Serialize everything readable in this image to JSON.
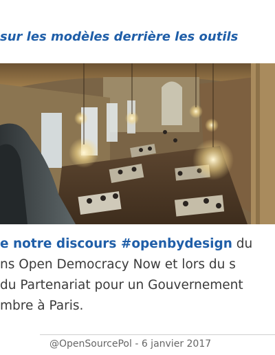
{
  "slide": {
    "headline": "sur les modèles derrière les outils",
    "body": {
      "line1_bold": "e notre discours #openbydesign",
      "line1_rest": " du",
      "line2": "ns Open Democracy Now et lors du s",
      "line3": "du Partenariat pour un Gouvernement",
      "line4": "mbre à Paris."
    },
    "footer": "@OpenSourcePol - 6 janvier 2017"
  },
  "colors": {
    "accent": "#1f5ea8",
    "text": "#3a3a3a",
    "footer": "#666666"
  }
}
